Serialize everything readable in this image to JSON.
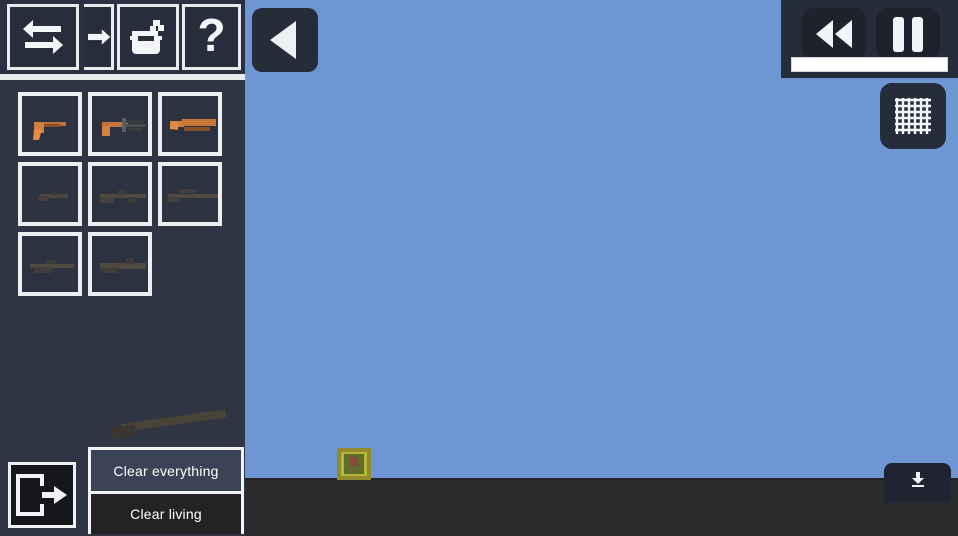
{
  "app": {
    "title": "People Playground — weapon selection sandbox",
    "sky_color": "#6e96d4",
    "ground_color": "#2b2b2d",
    "sidebar_color": "#2f3542",
    "panel_color": "#262c3a",
    "accent_color": "#eceef2"
  },
  "toolbar": {
    "buttons": [
      {
        "id": "swap",
        "icon": "swap-arrows-icon",
        "label": "Swap / transfer"
      },
      {
        "id": "insert",
        "icon": "arrow-into-icon",
        "label": "Insert"
      },
      {
        "id": "paint",
        "icon": "paint-bucket-icon",
        "label": "Paint bucket"
      },
      {
        "id": "help",
        "icon": "question-mark-icon",
        "label": "Help",
        "glyph": "?"
      }
    ]
  },
  "weapon_grid": {
    "columns": 3,
    "slots": [
      {
        "index": 0,
        "icon": "weapon-pistol-icon",
        "label": "Pistol",
        "tone": "bright"
      },
      {
        "index": 1,
        "icon": "weapon-smg-icon",
        "label": "SMG",
        "tone": "bright"
      },
      {
        "index": 2,
        "icon": "weapon-shotgun-icon",
        "label": "Shotgun",
        "tone": "bright"
      },
      {
        "index": 3,
        "icon": "weapon-rifle-icon",
        "label": "Rifle",
        "tone": "dim"
      },
      {
        "index": 4,
        "icon": "weapon-carbine-icon",
        "label": "Carbine",
        "tone": "dim"
      },
      {
        "index": 5,
        "icon": "weapon-sniper-icon",
        "label": "Sniper rifle",
        "tone": "dim"
      },
      {
        "index": 6,
        "icon": "weapon-machinegun-icon",
        "label": "Machine gun",
        "tone": "dim"
      },
      {
        "index": 7,
        "icon": "weapon-launcher-icon",
        "label": "Launcher",
        "tone": "dim"
      }
    ]
  },
  "sidebar": {
    "exit_button": {
      "icon": "exit-door-icon",
      "label": "Exit"
    },
    "dragged_item": {
      "icon": "weapon-launcher-icon",
      "label": "Launcher"
    }
  },
  "clear_menu": {
    "everything_label": "Clear everything",
    "living_label": "Clear living"
  },
  "overlay": {
    "collapse_button": {
      "icon": "triangle-left-icon",
      "label": "Collapse panel"
    },
    "grid_button": {
      "icon": "grid-icon",
      "label": "Toggle grid"
    },
    "download_button": {
      "icon": "download-icon",
      "label": "Download"
    }
  },
  "transport": {
    "rewind_button": {
      "icon": "rewind-icon",
      "label": "Rewind"
    },
    "pause_button": {
      "icon": "pause-icon",
      "label": "Pause"
    },
    "speed_slider": {
      "name": "speed-slider",
      "value": "100",
      "min": "0",
      "max": "100"
    }
  },
  "world": {
    "crate": {
      "name": "crate-object",
      "label": "Crate"
    },
    "ground": {
      "label": "Ground"
    }
  }
}
